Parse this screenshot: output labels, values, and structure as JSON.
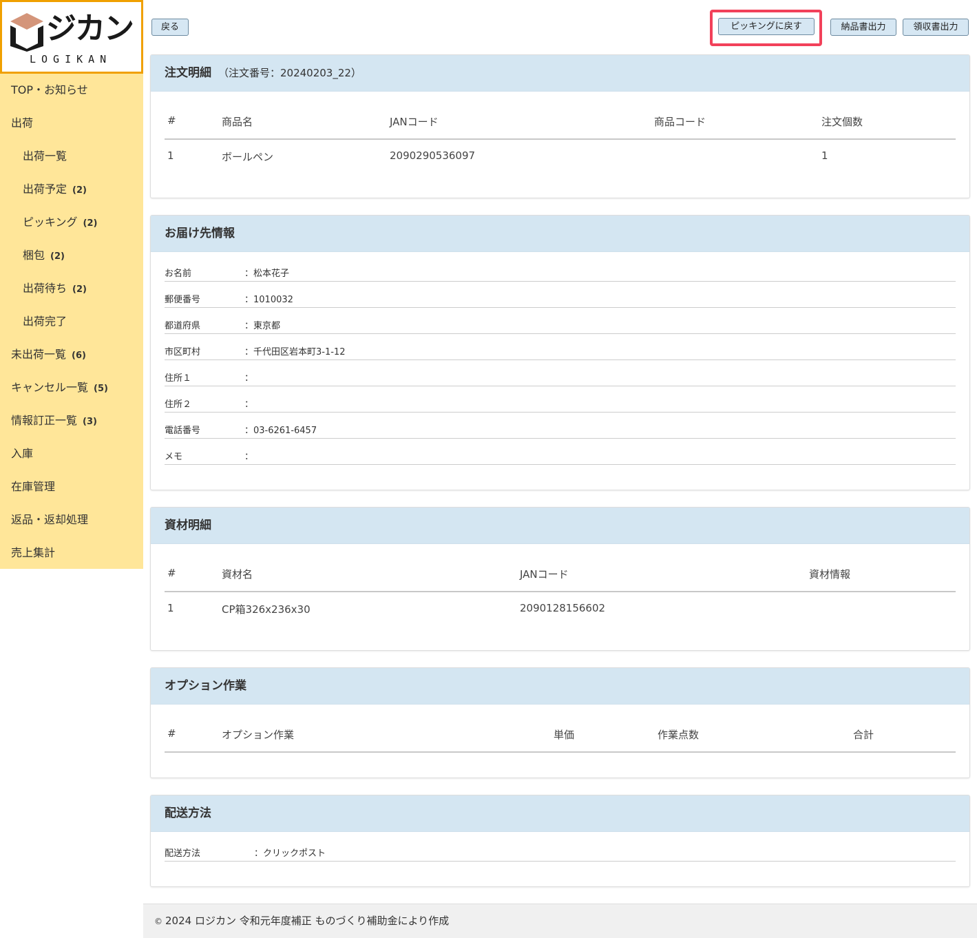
{
  "brand": {
    "name": "ジカン",
    "sub": "LOGIKAN"
  },
  "sidebar": {
    "items": [
      {
        "label": "TOP・お知らせ",
        "count": ""
      },
      {
        "label": "出荷",
        "count": ""
      },
      {
        "label": "出荷一覧",
        "count": ""
      },
      {
        "label": "出荷予定",
        "count": "(2)"
      },
      {
        "label": "ピッキング",
        "count": "(2)"
      },
      {
        "label": "梱包",
        "count": "(2)"
      },
      {
        "label": "出荷待ち",
        "count": "(2)"
      },
      {
        "label": "出荷完了",
        "count": ""
      },
      {
        "label": "未出荷一覧",
        "count": "(6)"
      },
      {
        "label": "キャンセル一覧",
        "count": "(5)"
      },
      {
        "label": "情報訂正一覧",
        "count": "(3)"
      },
      {
        "label": "入庫",
        "count": ""
      },
      {
        "label": "在庫管理",
        "count": ""
      },
      {
        "label": "返品・返却処理",
        "count": ""
      },
      {
        "label": "売上集計",
        "count": ""
      }
    ]
  },
  "toolbar": {
    "back": "戻る",
    "back_to_picking": "ピッキングに戻す",
    "delivery_note": "納品書出力",
    "receipt": "領収書出力"
  },
  "order": {
    "title": "注文明細",
    "order_no": "（注文番号：20240203_22）",
    "headers": [
      "#",
      "商品名",
      "JANコード",
      "商品コード",
      "注文個数"
    ],
    "rows": [
      [
        "1",
        "ボールペン",
        "2090290536097",
        "",
        "1"
      ]
    ]
  },
  "delivery": {
    "title": "お届け先情報",
    "rows": [
      {
        "k": "お名前",
        "v": "：松本花子"
      },
      {
        "k": "郵便番号",
        "v": "：1010032"
      },
      {
        "k": "都道府県",
        "v": "：東京都"
      },
      {
        "k": "市区町村",
        "v": "：千代田区岩本町3-1-12"
      },
      {
        "k": "住所１",
        "v": "："
      },
      {
        "k": "住所２",
        "v": "："
      },
      {
        "k": "電話番号",
        "v": "：03-6261-6457"
      },
      {
        "k": "メモ",
        "v": "："
      }
    ]
  },
  "materials": {
    "title": "資材明細",
    "headers": [
      "#",
      "資材名",
      "JANコード",
      "資材情報"
    ],
    "rows": [
      [
        "1",
        "CP箱326x236x30",
        "2090128156602",
        ""
      ]
    ]
  },
  "options": {
    "title": "オプション作業",
    "headers": [
      "#",
      "オプション作業",
      "単価",
      "作業点数",
      "合計"
    ]
  },
  "shipping": {
    "title": "配送方法",
    "label": "配送方法",
    "value": "：クリックポスト"
  },
  "footer": {
    "copyright": "©",
    "text": "2024 ロジカン 令和元年度補正 ものづくり補助金により作成"
  },
  "colors": {
    "sidebar_bg": "#ffe699",
    "logo_border": "#f0a000",
    "panel_header_bg": "#d4e6f2",
    "button_bg": "#d6e7f3",
    "highlight": "#f2415a"
  }
}
